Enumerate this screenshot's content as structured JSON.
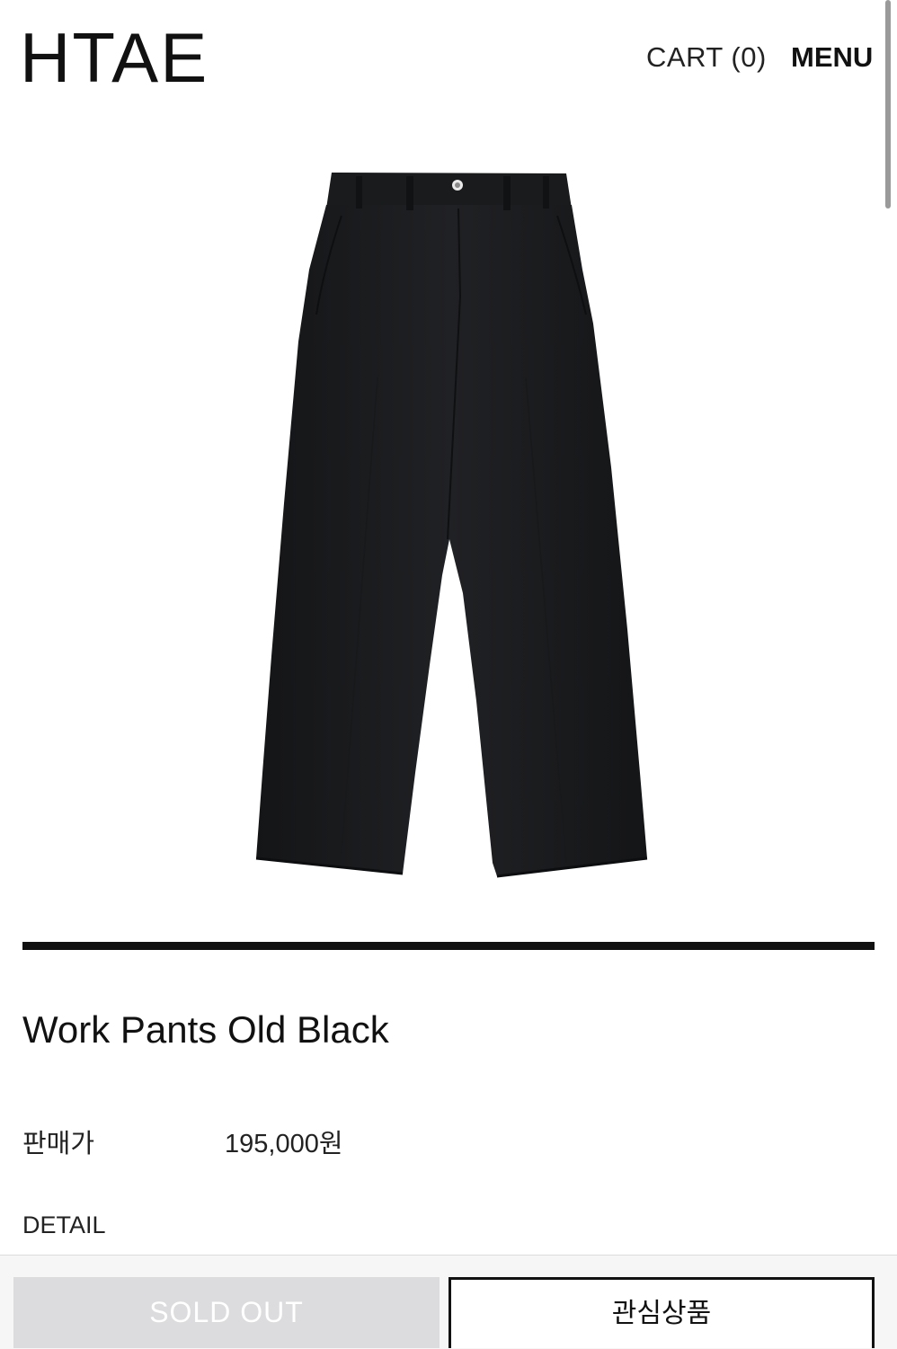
{
  "header": {
    "logo": "HTAE",
    "cart_label": "CART (0)",
    "menu_label": "MENU"
  },
  "product": {
    "image_icon": "pants-image",
    "title": "Work Pants Old Black",
    "price_label": "판매가",
    "price_value": "195,000원",
    "detail_label": "DETAIL"
  },
  "actions": {
    "sold_out_label": "SOLD OUT",
    "wishlist_label": "관심상품"
  },
  "colors": {
    "text": "#111111",
    "pants": "#1b1c1e",
    "sold_out_bg": "#dcdcde"
  }
}
